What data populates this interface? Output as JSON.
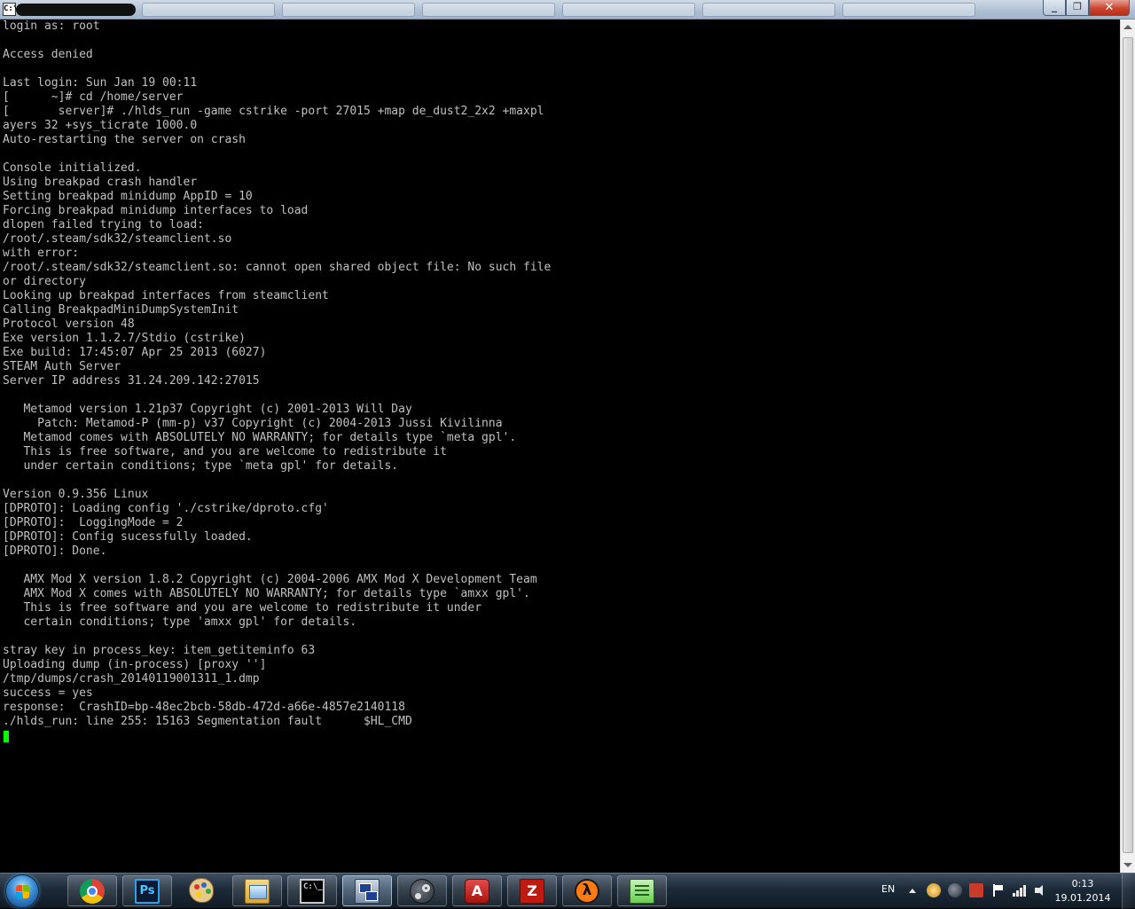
{
  "window": {
    "icon_label": "C:\\"
  },
  "terminal": {
    "lines": [
      "login as: root",
      "",
      "Access denied",
      "",
      "Last login: Sun Jan 19 00:11",
      "[      ~]# cd /home/server",
      "[       server]# ./hlds_run -game cstrike -port 27015 +map de_dust2_2x2 +maxpl",
      "ayers 32 +sys_ticrate 1000.0",
      "Auto-restarting the server on crash",
      "",
      "Console initialized.",
      "Using breakpad crash handler",
      "Setting breakpad minidump AppID = 10",
      "Forcing breakpad minidump interfaces to load",
      "dlopen failed trying to load:",
      "/root/.steam/sdk32/steamclient.so",
      "with error:",
      "/root/.steam/sdk32/steamclient.so: cannot open shared object file: No such file",
      "or directory",
      "Looking up breakpad interfaces from steamclient",
      "Calling BreakpadMiniDumpSystemInit",
      "Protocol version 48",
      "Exe version 1.1.2.7/Stdio (cstrike)",
      "Exe build: 17:45:07 Apr 25 2013 (6027)",
      "STEAM Auth Server",
      "Server IP address 31.24.209.142:27015",
      "",
      "   Metamod version 1.21p37 Copyright (c) 2001-2013 Will Day",
      "     Patch: Metamod-P (mm-p) v37 Copyright (c) 2004-2013 Jussi Kivilinna",
      "   Metamod comes with ABSOLUTELY NO WARRANTY; for details type `meta gpl'.",
      "   This is free software, and you are welcome to redistribute it",
      "   under certain conditions; type `meta gpl' for details.",
      "",
      "Version 0.9.356 Linux",
      "[DPROTO]: Loading config './cstrike/dproto.cfg'",
      "[DPROTO]:  LoggingMode = 2",
      "[DPROTO]: Config sucessfully loaded.",
      "[DPROTO]: Done.",
      "",
      "   AMX Mod X version 1.8.2 Copyright (c) 2004-2006 AMX Mod X Development Team",
      "   AMX Mod X comes with ABSOLUTELY NO WARRANTY; for details type `amxx gpl'.",
      "   This is free software and you are welcome to redistribute it under",
      "   certain conditions; type 'amxx gpl' for details.",
      "",
      "stray key in process_key: item_getiteminfo 63",
      "Uploading dump (in-process) [proxy '']",
      "/tmp/dumps/crash_20140119001311_1.dmp",
      "success = yes",
      "response:  CrashID=bp-48ec2bcb-58db-472d-a66e-4857e2140118",
      "./hlds_run: line 255: 15163 Segmentation fault      $HL_CMD"
    ],
    "text_color": "#c0c0c0",
    "background_color": "#000000",
    "cursor_color": "#00ff00"
  },
  "taskbar": {
    "apps": [
      {
        "name": "Google Chrome",
        "icon": "chrome-icon",
        "state": "running"
      },
      {
        "name": "Adobe Photoshop",
        "icon": "photoshop-icon",
        "label": "Ps",
        "state": "running"
      },
      {
        "name": "Paint",
        "icon": "palette-icon",
        "state": "pinned"
      },
      {
        "name": "Windows Explorer",
        "icon": "folder-icon",
        "state": "running"
      },
      {
        "name": "Command Prompt",
        "icon": "cmd-icon",
        "label": "C:\\_",
        "state": "running"
      },
      {
        "name": "PuTTY",
        "icon": "putty-icon",
        "state": "active"
      },
      {
        "name": "Steam",
        "icon": "steam-icon",
        "state": "running"
      },
      {
        "name": "Adobe Reader",
        "icon": "acrobat-icon",
        "label": "A",
        "state": "running"
      },
      {
        "name": "FileZilla",
        "icon": "filezilla-icon",
        "label": "Z",
        "state": "running"
      },
      {
        "name": "Half-Life",
        "icon": "halflife-icon",
        "label": "λ",
        "state": "running"
      },
      {
        "name": "Notepad++",
        "icon": "notepad-icon",
        "state": "running"
      }
    ],
    "tray": {
      "language": "EN",
      "time": "0:13",
      "date": "19.01.2014"
    }
  }
}
